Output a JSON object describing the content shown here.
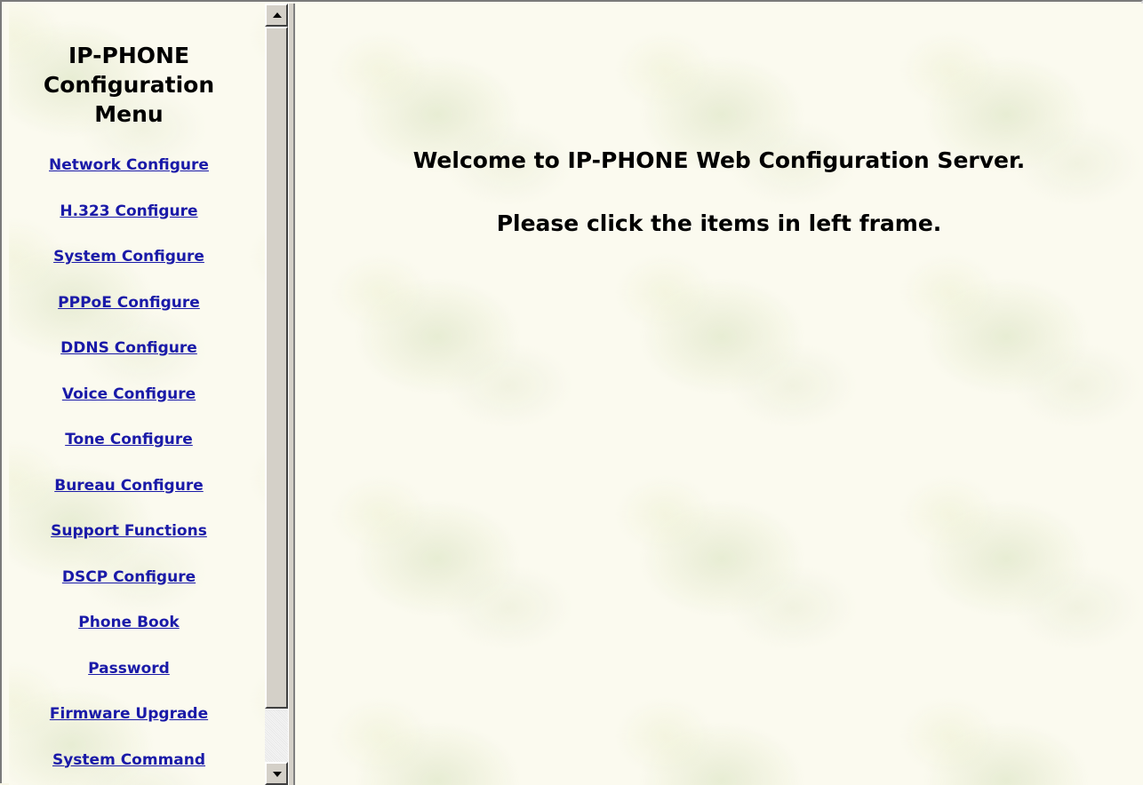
{
  "left_frame": {
    "title_lines": [
      "IP-PHONE",
      "Configuration",
      "Menu"
    ],
    "menu_items": [
      {
        "label": "Network Configure"
      },
      {
        "label": "H.323 Configure"
      },
      {
        "label": "System Configure"
      },
      {
        "label": "PPPoE Configure"
      },
      {
        "label": "DDNS Configure"
      },
      {
        "label": "Voice Configure"
      },
      {
        "label": "Tone Configure"
      },
      {
        "label": "Bureau Configure"
      },
      {
        "label": "Support Functions"
      },
      {
        "label": "DSCP Configure"
      },
      {
        "label": "Phone Book"
      },
      {
        "label": "Password"
      },
      {
        "label": "Firmware Upgrade"
      },
      {
        "label": "System Command"
      }
    ],
    "link_color": "#1a1aa8"
  },
  "right_frame": {
    "welcome_text": "Welcome to IP-PHONE Web Configuration Server.",
    "instruction_text": "Please click the items in left frame."
  },
  "icons": {
    "scroll_up": "arrow-up-icon",
    "scroll_down": "arrow-down-icon"
  }
}
